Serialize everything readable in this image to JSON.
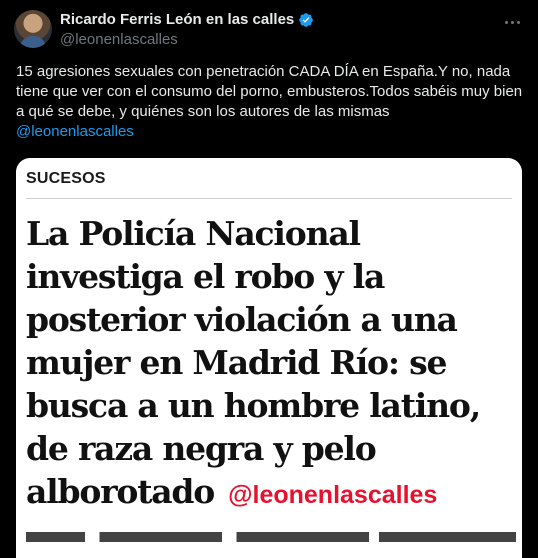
{
  "author": {
    "name": "Ricardo Ferris León en las calles",
    "handle": "@leonenlascalles"
  },
  "tweet": {
    "text": "15 agresiones sexuales con penetración CADA DÍA en España.Y no, nada tiene que ver con el consumo del porno, embusteros.Todos sabéis muy bien a qué se debe, y quiénes son los autores de las mismas",
    "mention": "@leonenlascalles"
  },
  "article": {
    "section": "SUCESOS",
    "headline": "La Policía Nacional investiga el robo y la posterior violación a una mujer en Madrid Río: se busca a un hombre latino, de raza negra y pelo alborotado",
    "watermark": "@leonenlascalles"
  },
  "colors": {
    "accent": "#1d9bf0",
    "verified": "#1d9bf0",
    "watermark": "#e8112d"
  },
  "icons": [
    "avatar",
    "verified-badge-icon",
    "more-options-icon"
  ]
}
